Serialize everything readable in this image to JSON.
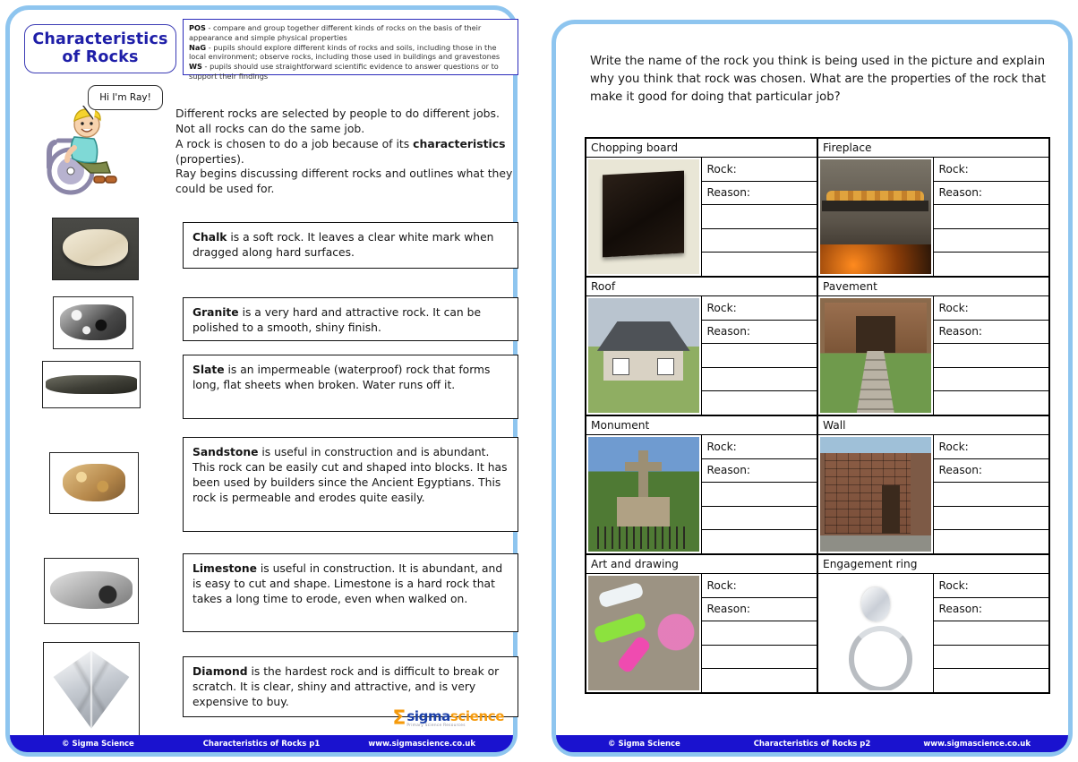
{
  "left_page": {
    "title_line1": "Characteristics",
    "title_line2": "of Rocks",
    "curriculum": {
      "pos_label": "POS",
      "pos_text": " - compare and group together different kinds of rocks on the basis of their appearance and simple physical properties",
      "nag_label": "NaG",
      "nag_text": " - pupils should explore different kinds of rocks and soils, including those in the local environment; observe rocks, including those used in buildings and gravestones",
      "ws_label": "WS",
      "ws_text": " - pupils should use straightforward scientific evidence to answer questions or to support their findings"
    },
    "character": {
      "speech": "Hi I'm Ray!",
      "name": "ray-character"
    },
    "intro": {
      "p1": "Different rocks are selected by people to do different jobs. Not all rocks can do the same job.",
      "p2_a": "A rock is chosen to do a job because of its ",
      "p2_bold": "characteristics",
      "p2_b": " (properties).",
      "p3": "Ray begins discussing different rocks and outlines what they could be used for."
    },
    "rocks": [
      {
        "name": "Chalk",
        "photo": "chalk-rock-photo",
        "text": " is a soft rock. It leaves a clear white mark when dragged along hard surfaces."
      },
      {
        "name": "Granite",
        "photo": "granite-rock-photo",
        "text": " is a very hard and attractive rock. It can be polished to a smooth, shiny finish."
      },
      {
        "name": "Slate",
        "photo": "slate-rock-photo",
        "text": " is an impermeable (waterproof) rock that forms long, flat sheets when broken. Water runs off it."
      },
      {
        "name": "Sandstone",
        "photo": "sandstone-rock-photo",
        "text": " is useful in construction and is abundant. This rock can be easily cut and shaped into blocks. It has been used by builders since the Ancient Egyptians. This rock is permeable and erodes quite easily."
      },
      {
        "name": "Limestone",
        "photo": "limestone-rock-photo",
        "text": " is useful in construction.  It is abundant, and is easy to cut and shape. Limestone is a hard rock that takes a long time to erode, even when walked on."
      },
      {
        "name": "Diamond",
        "photo": "diamond-photo",
        "text": " is the hardest rock and is difficult to break or scratch. It is clear, shiny and attractive, and is very expensive to buy."
      }
    ],
    "logo": {
      "sigma": "Σ",
      "word_a": "sigma",
      "word_b": "science",
      "tagline": "Primary Science Resources"
    },
    "footer": {
      "copyright": "© Sigma Science",
      "title": "Characteristics of Rocks p1",
      "url": "www.sigmascience.co.uk"
    }
  },
  "right_page": {
    "question": "Write the name of the rock you think is being used in the picture and explain why you think that rock was chosen. What are the properties of the rock that make it good for doing that particular job?",
    "field_labels": {
      "rock": "Rock:",
      "reason": "Reason:"
    },
    "grid": [
      [
        {
          "title": "Chopping board",
          "photo": "chopping-board-photo",
          "lines": [
            "Rock:",
            "Reason:",
            "",
            "",
            ""
          ]
        },
        {
          "title": "Fireplace",
          "photo": "fireplace-photo",
          "lines": [
            "Rock:",
            "Reason:",
            "",
            "",
            ""
          ]
        }
      ],
      [
        {
          "title": "Roof",
          "photo": "roof-photo",
          "lines": [
            "Rock:",
            "Reason:",
            "",
            "",
            ""
          ]
        },
        {
          "title": "Pavement",
          "photo": "pavement-photo",
          "lines": [
            "Rock:",
            "Reason:",
            "",
            "",
            ""
          ]
        }
      ],
      [
        {
          "title": "Monument",
          "photo": "monument-photo",
          "lines": [
            "Rock:",
            "Reason:",
            "",
            "",
            ""
          ]
        },
        {
          "title": "Wall",
          "photo": "wall-photo",
          "lines": [
            "Rock:",
            "Reason:",
            "",
            "",
            ""
          ]
        }
      ],
      [
        {
          "title": "Art and drawing",
          "photo": "art-and-drawing-photo",
          "lines": [
            "Rock:",
            "Reason:",
            "",
            "",
            ""
          ]
        },
        {
          "title": "Engagement ring",
          "photo": "engagement-ring-photo",
          "lines": [
            "Rock:",
            "Reason:",
            "",
            "",
            ""
          ]
        }
      ]
    ],
    "footer": {
      "copyright": "© Sigma Science",
      "title": "Characteristics of Rocks p2",
      "url": "www.sigmascience.co.uk"
    }
  },
  "colors": {
    "page_border": "#8ec5ef",
    "footer_bar": "#1a12cf",
    "title_text": "#1e1ea8",
    "logo_orange": "#f59a0c",
    "logo_blue": "#1a3fa8"
  }
}
